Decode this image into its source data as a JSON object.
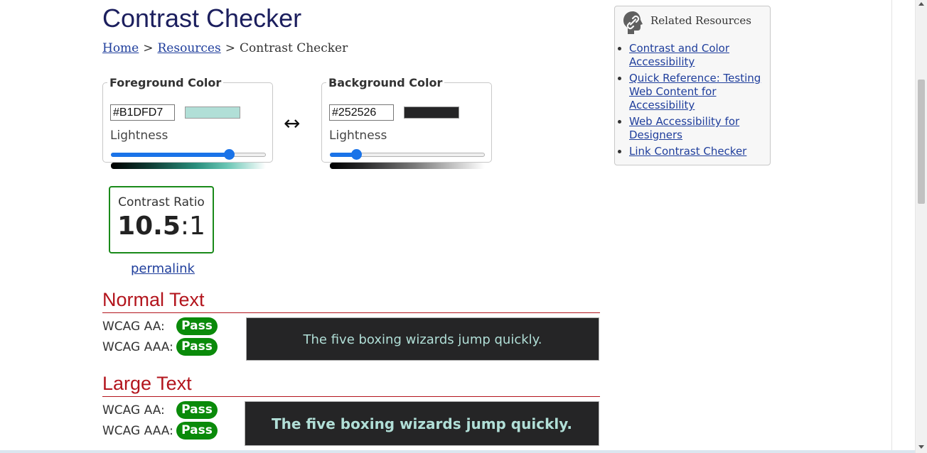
{
  "page": {
    "title": "Contrast Checker"
  },
  "breadcrumb": {
    "home": "Home",
    "resources": "Resources",
    "current": "Contrast Checker",
    "separator": ">"
  },
  "foreground": {
    "legend": "Foreground Color",
    "hex": "#B1DFD7",
    "swatch_color": "#B1DFD7",
    "lightness_label": "Lightness",
    "lightness_value": 0.76
  },
  "background": {
    "legend": "Background Color",
    "hex": "#252526",
    "swatch_color": "#252526",
    "lightness_label": "Lightness",
    "lightness_value": 0.17
  },
  "swap_icon": {
    "name": "left-right-arrow-icon",
    "glyph": "↔"
  },
  "contrast": {
    "label": "Contrast Ratio",
    "ratio_main": "10.5",
    "ratio_suffix": ":1",
    "border_color": "#1a8a1a"
  },
  "permalink": "permalink",
  "normal_text": {
    "heading": "Normal Text",
    "aa_label": "WCAG AA:",
    "aa_result": "Pass",
    "aaa_label": "WCAG AAA:",
    "aaa_result": "Pass",
    "sample": "The five boxing wizards jump quickly."
  },
  "large_text": {
    "heading": "Large Text",
    "aa_label": "WCAG AA:",
    "aa_result": "Pass",
    "aaa_label": "WCAG AAA:",
    "aaa_result": "Pass",
    "sample": "The five boxing wizards jump quickly."
  },
  "sidebar": {
    "title": "Related Resources",
    "icon": "link-icon",
    "links": [
      {
        "label": "Contrast and Color Accessibility"
      },
      {
        "label": "Quick Reference: Testing Web Content for Accessibility"
      },
      {
        "label": "Web Accessibility for Designers"
      },
      {
        "label": "Link Contrast Checker"
      }
    ]
  },
  "colors": {
    "pass": "#0a8a0a",
    "heading_red": "#b3151d",
    "link": "#1f3e9c",
    "slider_blue": "#1a73e8"
  }
}
